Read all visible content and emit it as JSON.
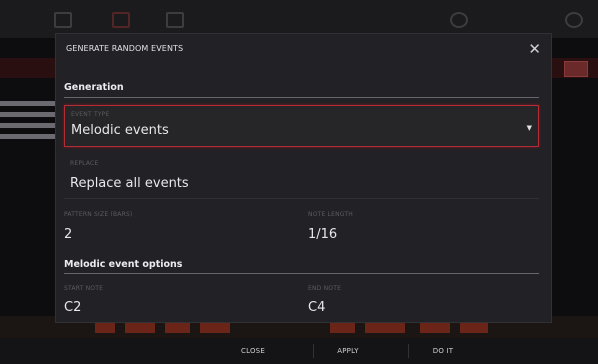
{
  "dialog": {
    "title": "GENERATE RANDOM EVENTS",
    "close_symbol": "✕"
  },
  "generation": {
    "heading": "Generation",
    "event_type": {
      "label": "EVENT TYPE",
      "value": "Melodic events"
    },
    "replace": {
      "label": "REPLACE",
      "value": "Replace all events"
    },
    "pattern_size": {
      "label": "PATTERN SIZE (BARS)",
      "value": "2"
    },
    "note_length": {
      "label": "NOTE LENGTH",
      "value": "1/16"
    }
  },
  "melodic": {
    "heading": "Melodic event options",
    "start_note": {
      "label": "START NOTE",
      "value": "C2"
    },
    "end_note": {
      "label": "END NOTE",
      "value": "C4"
    }
  },
  "footer": {
    "close": "CLOSE",
    "apply": "APPLY",
    "do_it": "DO IT"
  },
  "icons": {
    "close": "close-icon",
    "dropdown": "dropdown-arrow-icon"
  },
  "colors": {
    "accent": "#b22d36",
    "dialog_bg": "#222226"
  }
}
